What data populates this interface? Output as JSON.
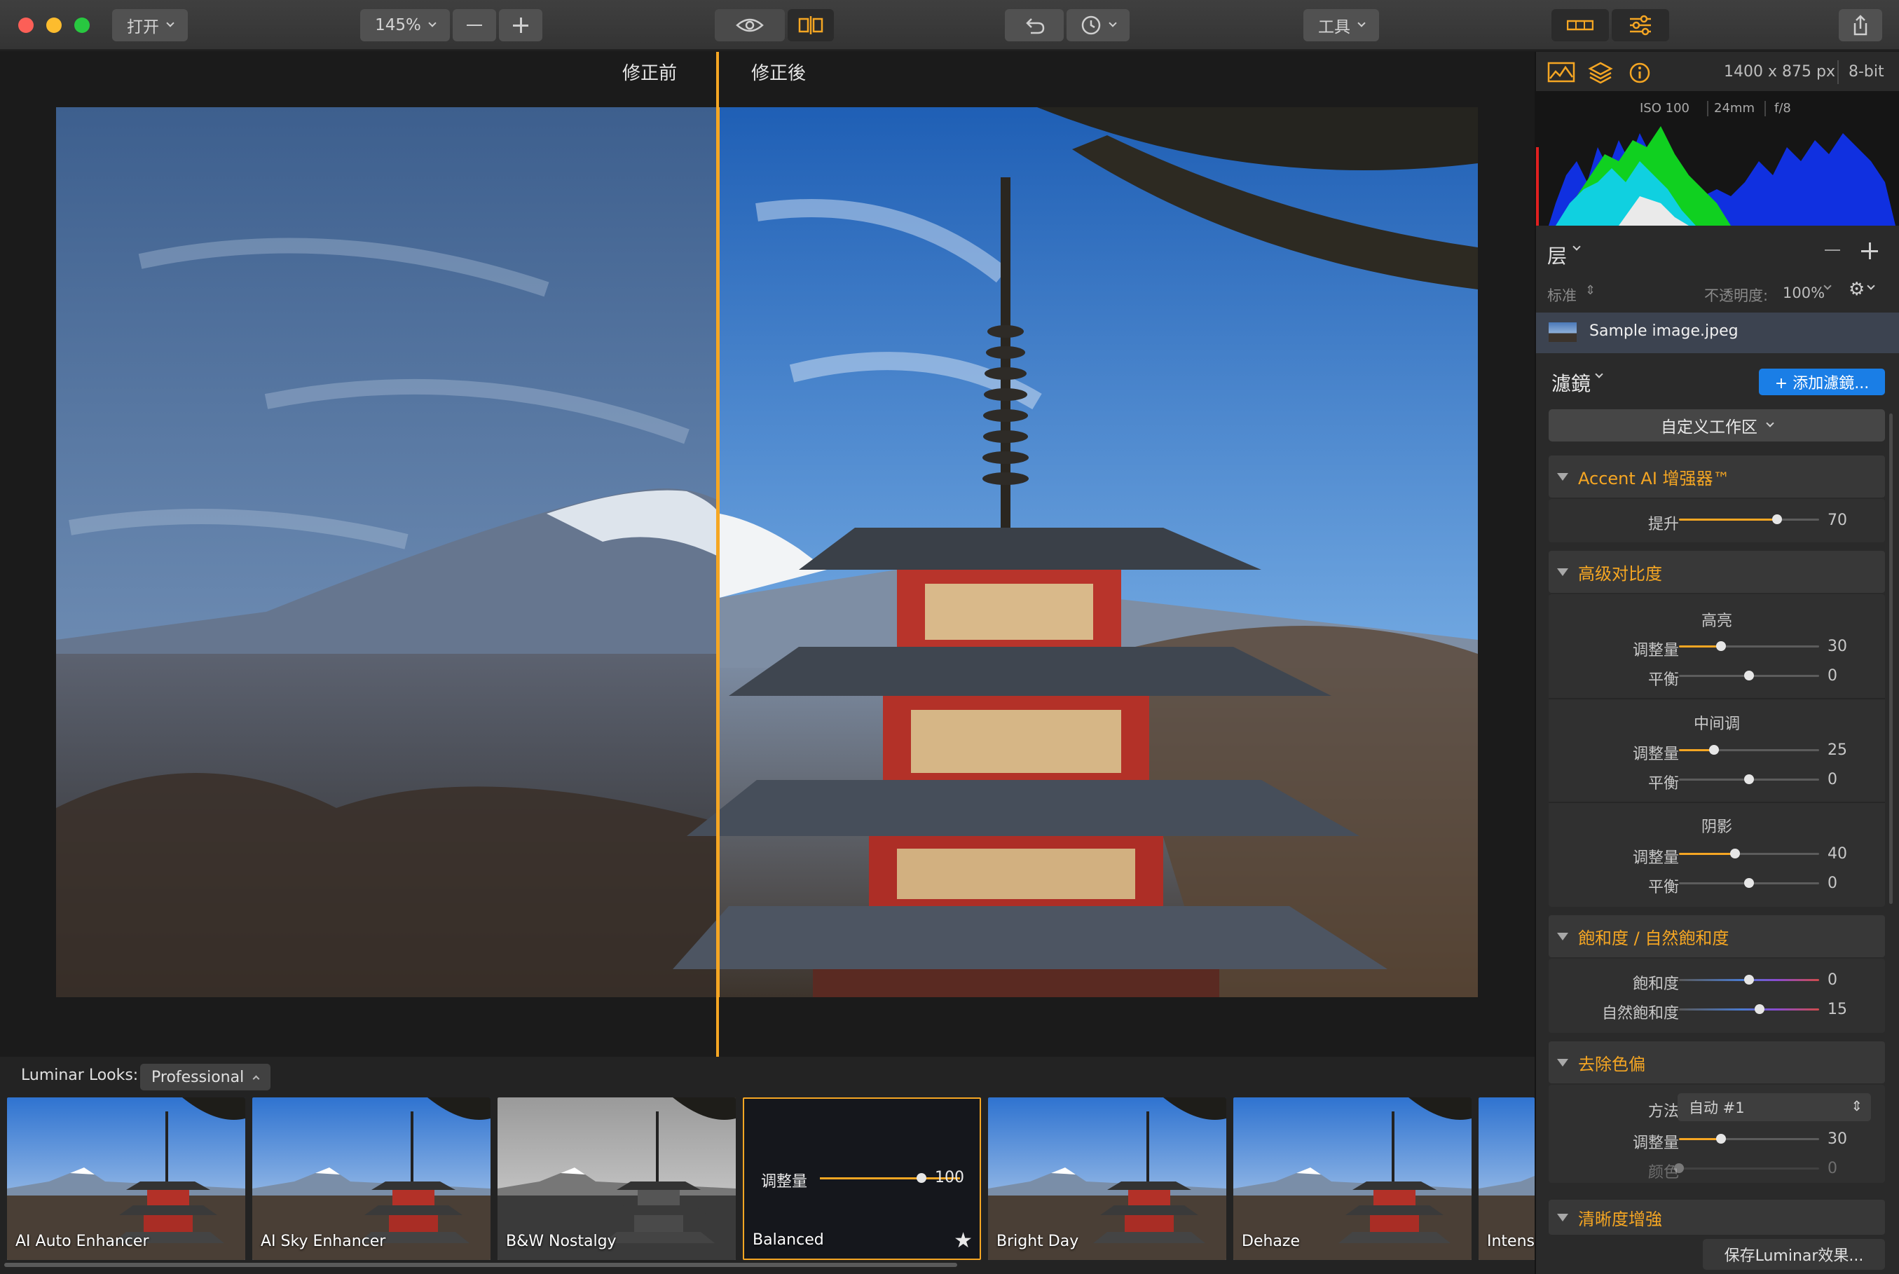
{
  "titlebar": {
    "open_label": "打开",
    "zoom_value": "145%",
    "tools_label": "工具"
  },
  "canvas": {
    "before_label": "修正前",
    "after_label": "修正後"
  },
  "looks": {
    "label": "Luminar Looks:",
    "category": "Professional",
    "items": [
      {
        "name": "AI Auto Enhancer"
      },
      {
        "name": "AI Sky Enhancer"
      },
      {
        "name": "B&W Nostalgy"
      },
      {
        "name": "Balanced",
        "amount_label": "调整量",
        "amount_value": "100"
      },
      {
        "name": "Bright Day"
      },
      {
        "name": "Dehaze"
      },
      {
        "name": "Intensi"
      }
    ]
  },
  "info": {
    "dimensions": "1400 x 875 px",
    "bit_depth": "8-bit",
    "iso": "ISO 100",
    "focal": "24mm",
    "aperture": "f/8"
  },
  "layers": {
    "title": "层",
    "blend_mode": "标准",
    "opacity_label": "不透明度:",
    "opacity_value": "100%",
    "layer_name": "Sample image.jpeg"
  },
  "filters": {
    "title": "濾鏡",
    "add_button": "+ 添加濾鏡...",
    "workspace": "自定义工作区",
    "accent": {
      "title": "Accent AI 增强器™",
      "boost_label": "提升",
      "boost_value": "70",
      "boost_level": 0.7
    },
    "contrast": {
      "title": "高级对比度",
      "highlights": "高亮",
      "midtones": "中间调",
      "shadows": "阴影",
      "amount_label": "调整量",
      "balance_label": "平衡",
      "hl_amount": "30",
      "hl_balance": "0",
      "mid_amount": "25",
      "mid_balance": "0",
      "sh_amount": "40",
      "sh_balance": "0"
    },
    "saturation": {
      "title": "飽和度 / 自然飽和度",
      "sat_label": "飽和度",
      "sat_value": "0",
      "vib_label": "自然飽和度",
      "vib_value": "15"
    },
    "cast": {
      "title": "去除色偏",
      "method_label": "方法",
      "method_value": "自动 #1",
      "amount_label": "调整量",
      "amount_value": "30",
      "color_label": "颜色",
      "color_value": "0"
    },
    "clarity": {
      "title": "清晰度增強"
    },
    "save_button": "保存Luminar效果..."
  },
  "colors": {
    "accent": "#f5a623",
    "selection_blue": "#1a7ee6"
  }
}
